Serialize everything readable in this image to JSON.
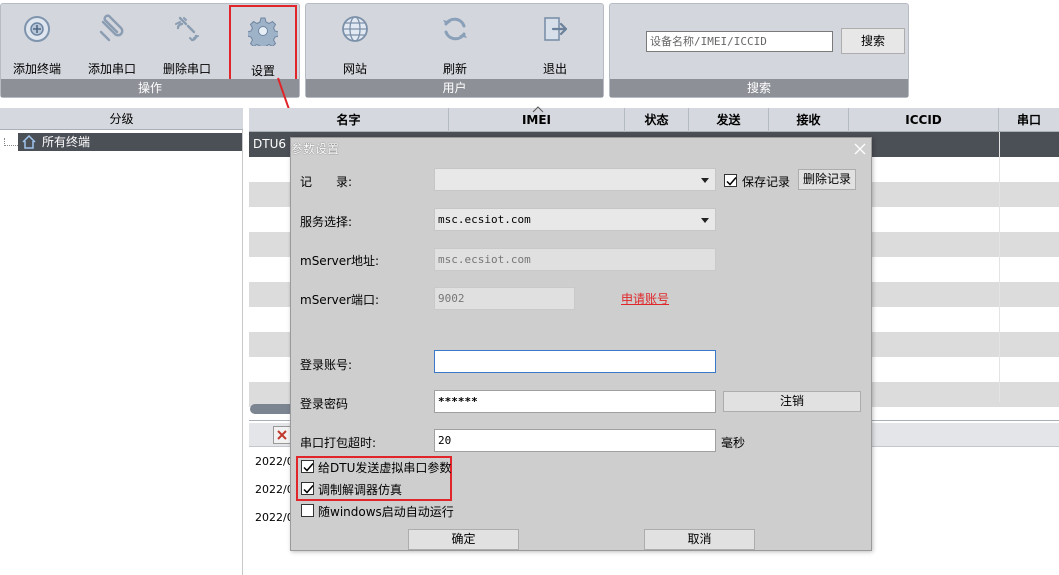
{
  "ribbon": {
    "groups": [
      {
        "caption": "操作",
        "buttons": [
          {
            "label": "添加终端",
            "icon": "add-terminal-icon"
          },
          {
            "label": "添加串口",
            "icon": "add-serial-icon"
          },
          {
            "label": "删除串口",
            "icon": "delete-serial-icon"
          },
          {
            "label": "设置",
            "icon": "gear-icon"
          }
        ]
      },
      {
        "caption": "用户",
        "buttons": [
          {
            "label": "网站",
            "icon": "globe-icon"
          },
          {
            "label": "刷新",
            "icon": "refresh-icon"
          },
          {
            "label": "退出",
            "icon": "exit-icon"
          }
        ]
      },
      {
        "caption": "搜索",
        "search_placeholder": "设备名称/IMEI/ICCID",
        "search_button": "搜索"
      }
    ]
  },
  "tree": {
    "header": "分级",
    "root_label": "所有终端"
  },
  "table": {
    "columns": [
      "名字",
      "IMEI",
      "状态",
      "发送",
      "接收",
      "ICCID",
      "串口"
    ],
    "selected_row_name": "DTU6"
  },
  "log": {
    "lines": [
      "2022/0",
      "2022/0",
      "2022/0"
    ]
  },
  "dialog": {
    "title": "参数设置",
    "record_label": "记　　录:",
    "record_value": "",
    "save_record_label": "保存记录",
    "save_record_checked": true,
    "delete_record_button": "删除记录",
    "service_label": "服务选择:",
    "service_value": "msc.ecsiot.com",
    "mserver_addr_label": "mServer地址:",
    "mserver_addr_value": "msc.ecsiot.com",
    "mserver_port_label": "mServer端口:",
    "mserver_port_value": "9002",
    "apply_account_link": "申请账号",
    "login_account_label": "登录账号:",
    "login_account_value": "",
    "login_password_label": "登录密码",
    "login_password_value": "******",
    "logout_button": "注销",
    "timeout_label": "串口打包超时:",
    "timeout_value": "20",
    "timeout_unit": "毫秒",
    "checkboxes": [
      {
        "label": "给DTU发送虚拟串口参数",
        "checked": true
      },
      {
        "label": "调制解调器仿真",
        "checked": true
      },
      {
        "label": "随windows启动自动运行",
        "checked": false
      }
    ],
    "ok_button": "确定",
    "cancel_button": "取消"
  },
  "colors": {
    "highlight": "#e0262a",
    "ribbon_bg": "#d3d6dc",
    "group_caption_bg": "#8d9097",
    "selected_row": "#4b4f56",
    "dialog_bg": "#cecece"
  }
}
